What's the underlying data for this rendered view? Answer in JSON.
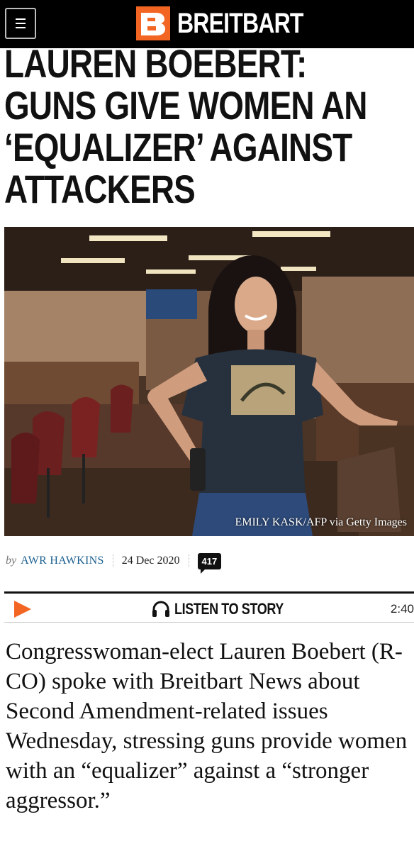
{
  "header": {
    "menu_icon": "hamburger-menu-icon",
    "brand_name": "BREITBART",
    "brand_color": "#f26522"
  },
  "article": {
    "headline": "LAUREN BOEBERT: GUNS GIVE WOMEN AN ‘EQUALIZER’ AGAINST ATTACKERS",
    "photo_caption": "EMILY KASK/AFP via Getty Images",
    "byline_prefix": "by",
    "author": "AWR HAWKINS",
    "date": "24 Dec 2020",
    "comment_count": "417",
    "body": "Congresswoman-elect Lauren Boebert (R-CO) spoke with Breitbart News about Second Amendment-related issues Wednesday, stressing guns provide women with an “equalizer” against a “stronger aggressor.”"
  },
  "audio": {
    "play_icon": "play-icon",
    "headphones_icon": "headphones-icon",
    "label": "LISTEN TO STORY",
    "duration": "2:40"
  }
}
